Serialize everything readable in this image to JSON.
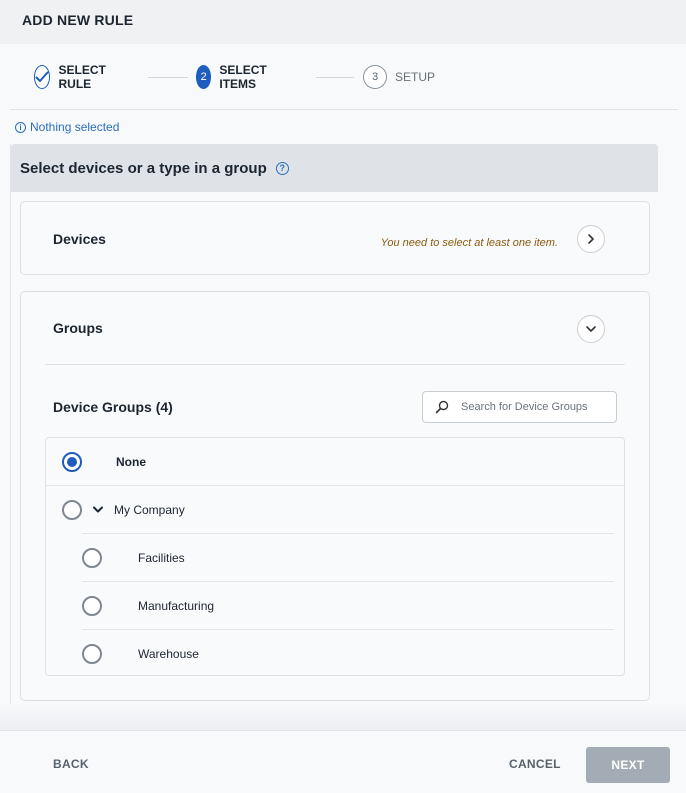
{
  "window": {
    "title": "ADD NEW RULE"
  },
  "stepper": {
    "steps": [
      {
        "number": "",
        "label": "SELECT RULE",
        "state": "done"
      },
      {
        "number": "2",
        "label": "SELECT ITEMS",
        "state": "active"
      },
      {
        "number": "3",
        "label": "SETUP",
        "state": "todo"
      }
    ]
  },
  "status": {
    "text": "Nothing selected"
  },
  "panel": {
    "title": "Select devices or a type in a group",
    "devices": {
      "title": "Devices",
      "warning": "You need to select at least one item."
    },
    "groups": {
      "title": "Groups",
      "device_groups_title": "Device Groups (4)",
      "search": {
        "placeholder": "Search for Device Groups",
        "value": ""
      },
      "tree": [
        {
          "label": "None",
          "selected": true,
          "bold": true
        },
        {
          "label": "My Company",
          "selected": false,
          "expanded": true
        },
        {
          "label": "Facilities",
          "selected": false
        },
        {
          "label": "Manufacturing",
          "selected": false
        },
        {
          "label": "Warehouse",
          "selected": false
        }
      ]
    }
  },
  "footer": {
    "back": "BACK",
    "cancel": "CANCEL",
    "next": "NEXT"
  },
  "colors": {
    "accent": "#1e5dbd",
    "link": "#2a6ebb",
    "warning": "#8a5a10",
    "disabled_button": "#a3abb4"
  }
}
